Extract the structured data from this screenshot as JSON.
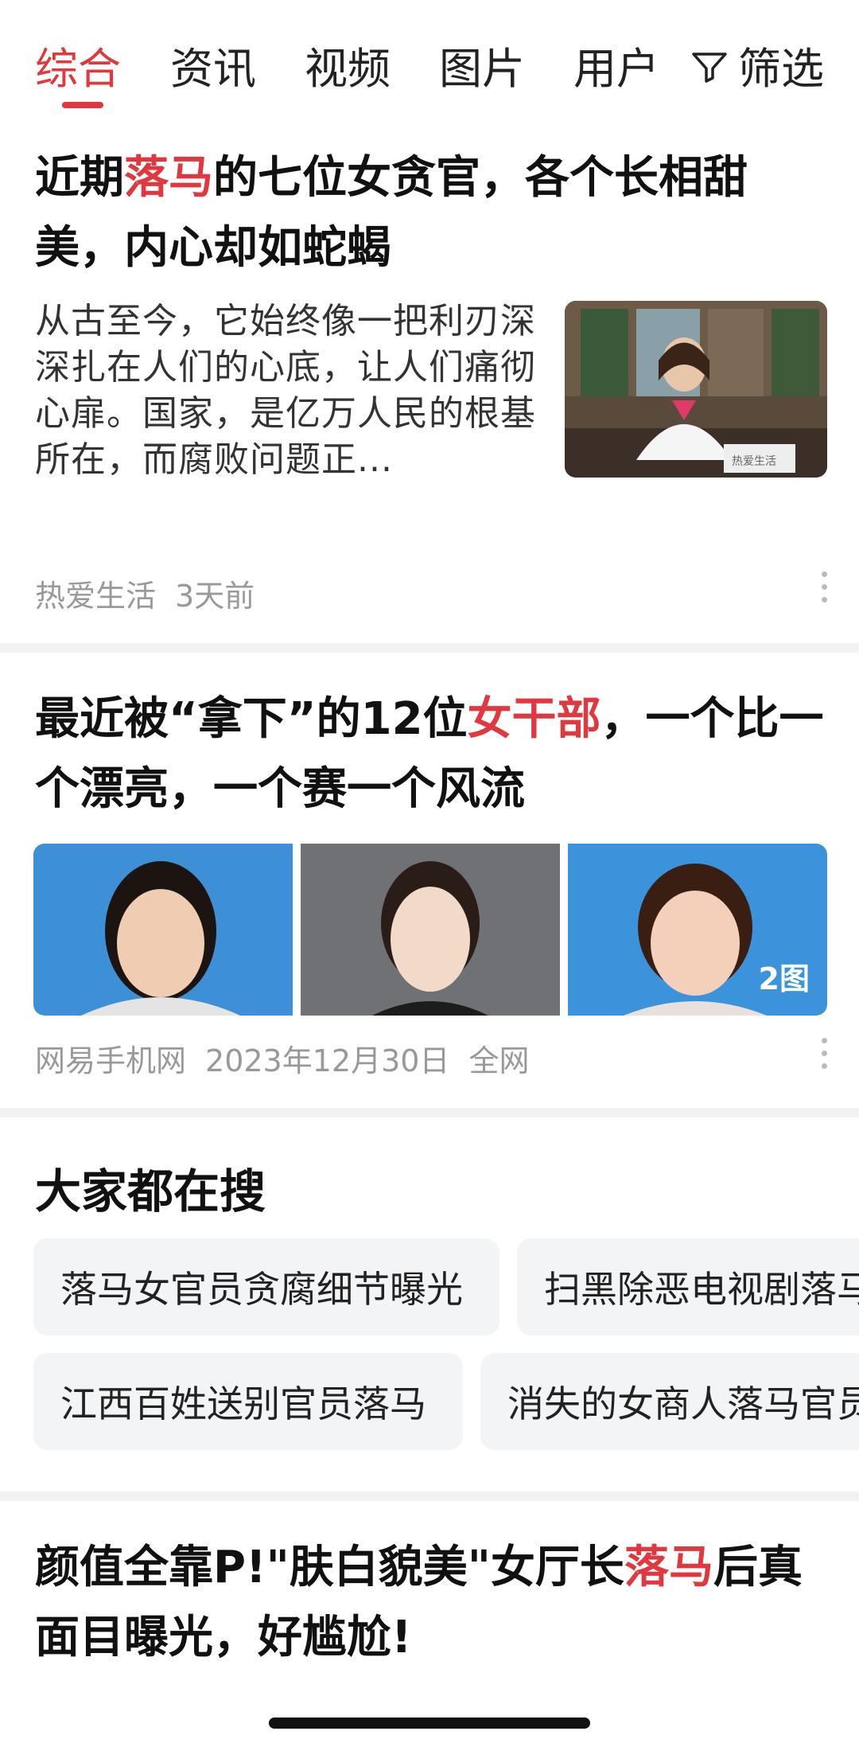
{
  "tabs": [
    {
      "label": "综合",
      "active": true
    },
    {
      "label": "资讯",
      "active": false
    },
    {
      "label": "视频",
      "active": false
    },
    {
      "label": "图片",
      "active": false
    },
    {
      "label": "用户",
      "active": false
    }
  ],
  "filter": {
    "label": "筛选",
    "icon": "filter-icon"
  },
  "articles": [
    {
      "title_parts": [
        "近期",
        "落马",
        "的七位女贪官，各个长相甜美，内心却如蛇蝎"
      ],
      "summary": "从古至今，它始终像一把利刃深深扎在人们的心底，让人们痛彻心扉。国家，是亿万人民的根基所在，而腐败问题正...",
      "thumb_caption": "热爱生活",
      "source": "热爱生活",
      "time": "3天前"
    },
    {
      "title_parts": [
        "最近被“拿下”的12位",
        "女干部",
        "，一个比一个漂亮，一个赛一个风流"
      ],
      "image_badge": "2图",
      "source": "网易手机网",
      "time": "2023年12月30日",
      "scope": "全网"
    },
    {
      "title_parts": [
        "颜值全靠P!\"肤白貌美\"女厅长",
        "落马",
        "后真面目曝光，好尴尬!"
      ]
    }
  ],
  "hot_search": {
    "title": "大家都在搜",
    "items": [
      "落马女官员贪腐细节曝光",
      "扫黑除恶电视剧落马",
      "江西百姓送别官员落马",
      "消失的女商人落马官员"
    ]
  },
  "colors": {
    "accent": "#e0383e",
    "meta": "#999999",
    "chip_bg": "#f3f4f6"
  }
}
